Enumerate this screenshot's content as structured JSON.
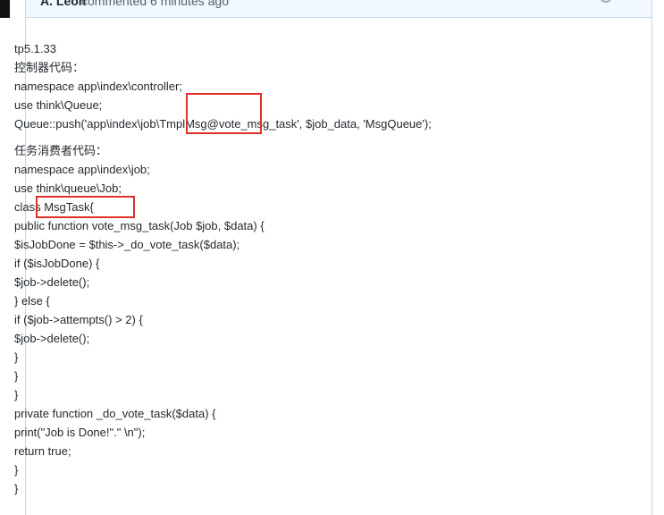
{
  "comment": {
    "author": "A. Leon",
    "meta": "commented 6 minutes ago",
    "lines_part1": [
      "tp5.1.33",
      "控制器代码：",
      "namespace app\\index\\controller;",
      "use think\\Queue;",
      "Queue::push('app\\index\\job\\TmplMsg@vote_msg_task', $job_data, 'MsgQueue');"
    ],
    "lines_part2": [
      "任务消费者代码：",
      "namespace app\\index\\job;",
      "use think\\queue\\Job;",
      "class MsgTask{",
      "public function vote_msg_task(Job $job, $data) {",
      "$isJobDone = $this->_do_vote_task($data);",
      "if ($isJobDone) {",
      "$job->delete();",
      "} else {",
      "if ($job->attempts() > 2) {",
      "$job->delete();",
      "}",
      "}",
      "}",
      "private function _do_vote_task($data) {",
      "print(\"Job is Done!\".\" \\n\");",
      "return true;",
      "}",
      "}"
    ]
  },
  "highlight_color": "#e0302b"
}
